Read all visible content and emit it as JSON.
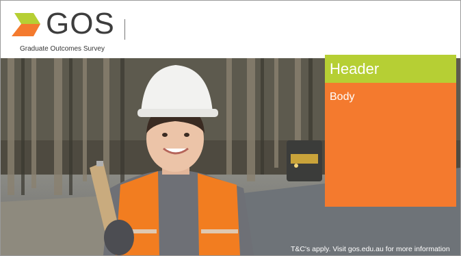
{
  "brand": {
    "logo_text": "GOS",
    "subtitle": "Graduate Outcomes Survey",
    "colors": {
      "green": "#b6cf34",
      "orange": "#f47a2e",
      "text": "#3d3d3d"
    }
  },
  "card": {
    "header": "Header",
    "body": "Body"
  },
  "footer": {
    "disclaimer": "T&C's apply. Visit gos.edu.au for more information"
  }
}
